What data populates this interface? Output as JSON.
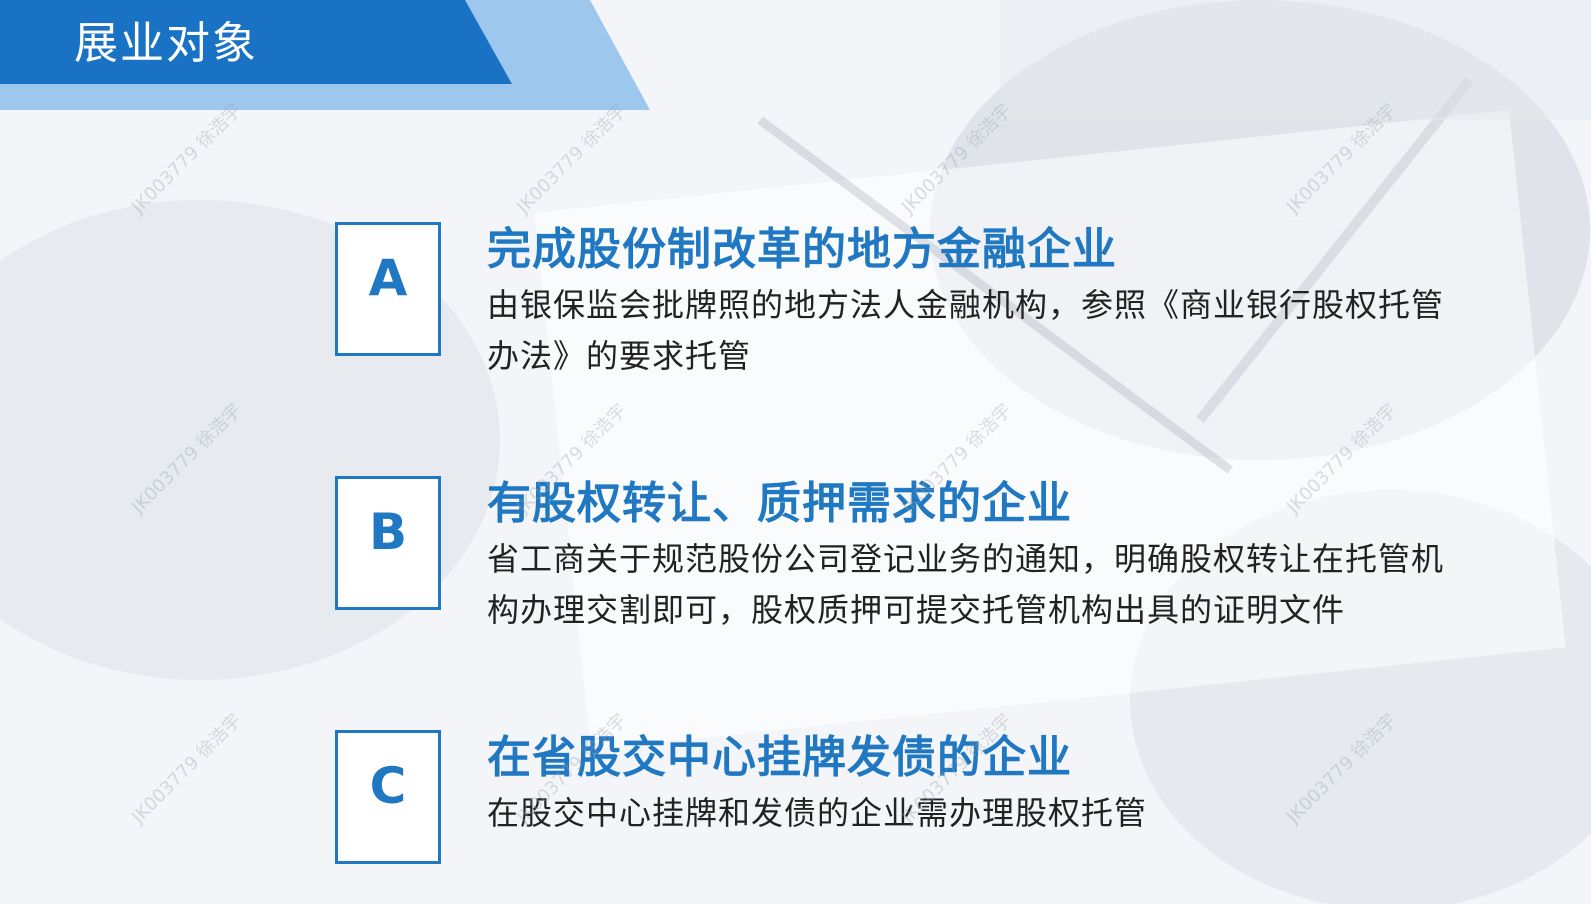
{
  "header": {
    "title": "展业对象"
  },
  "colors": {
    "accent": "#1f78c1",
    "header_bar": "#1a72c4",
    "header_stripe": "#9ec7ee"
  },
  "items": [
    {
      "letter": "A",
      "title": "完成股份制改革的地方金融企业",
      "description": "由银保监会批牌照的地方法人金融机构，参照《商业银行股权托管办法》的要求托管"
    },
    {
      "letter": "B",
      "title": "有股权转让、质押需求的企业",
      "description": "省工商关于规范股份公司登记业务的通知，明确股权转让在托管机构办理交割即可，股权质押可提交托管机构出具的证明文件"
    },
    {
      "letter": "C",
      "title": "在省股交中心挂牌发债的企业",
      "description": "在股交中心挂牌和发债的企业需办理股权托管"
    }
  ],
  "watermark": "JK003779 徐浩宇"
}
